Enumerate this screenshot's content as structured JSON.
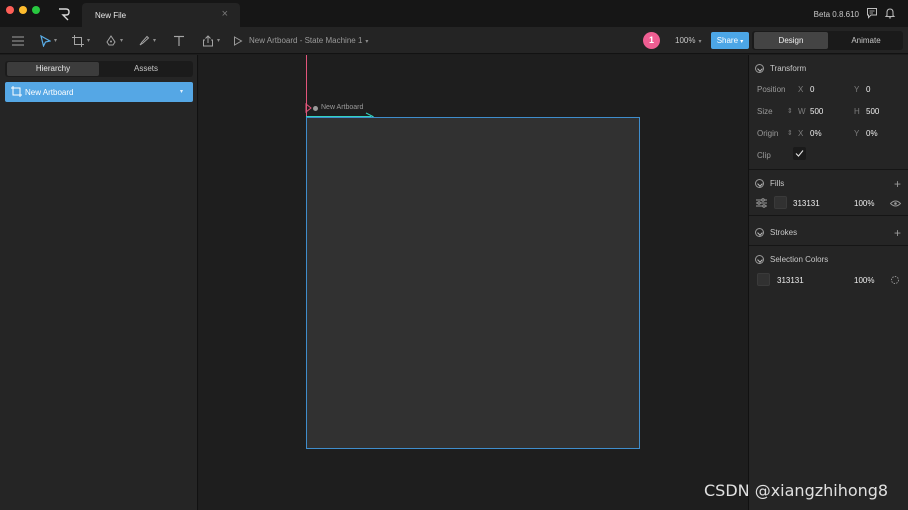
{
  "titlebar": {
    "tab_title": "New File",
    "version": "Beta 0.8.610",
    "icons": [
      "logo-icon",
      "close-icon",
      "chat-icon",
      "bell-icon"
    ]
  },
  "toolbar": {
    "state_machine": "New Artboard - State Machine 1",
    "notification_count": "1",
    "zoom": "100%",
    "share_label": "Share",
    "modes": {
      "design": "Design",
      "animate": "Animate"
    },
    "tools": [
      "menu-icon",
      "select-tool-icon",
      "artboard-tool-icon",
      "pen-tool-icon",
      "brush-tool-icon",
      "text-tool-icon",
      "export-icon",
      "play-icon"
    ]
  },
  "left_panel": {
    "tabs": {
      "hierarchy": "Hierarchy",
      "assets": "Assets"
    },
    "items": [
      {
        "label": "New Artboard"
      }
    ]
  },
  "canvas": {
    "artboard_label": "New Artboard",
    "artboard_color": "#313131",
    "selection_color": "#3f8dcc"
  },
  "right_panel": {
    "transform": {
      "title": "Transform",
      "position_label": "Position",
      "x_axis": "X",
      "position_x": "0",
      "y_axis": "Y",
      "position_y": "0",
      "size_label": "Size",
      "w_axis": "W",
      "width": "500",
      "h_axis": "H",
      "height": "500",
      "origin_label": "Origin",
      "origin_x": "0%",
      "origin_y": "0%",
      "clip_label": "Clip",
      "clip_checked": true
    },
    "fills": {
      "title": "Fills",
      "color": "313131",
      "opacity": "100%"
    },
    "strokes": {
      "title": "Strokes"
    },
    "selection_colors": {
      "title": "Selection Colors",
      "color": "313131",
      "opacity": "100%"
    }
  },
  "watermark": "CSDN @xiangzhihong8",
  "colors": {
    "accent": "#4ca6e6",
    "badge": "#ee5e92",
    "guide_vertical": "#e2557b",
    "guide_horizontal": "#34d3c0"
  }
}
